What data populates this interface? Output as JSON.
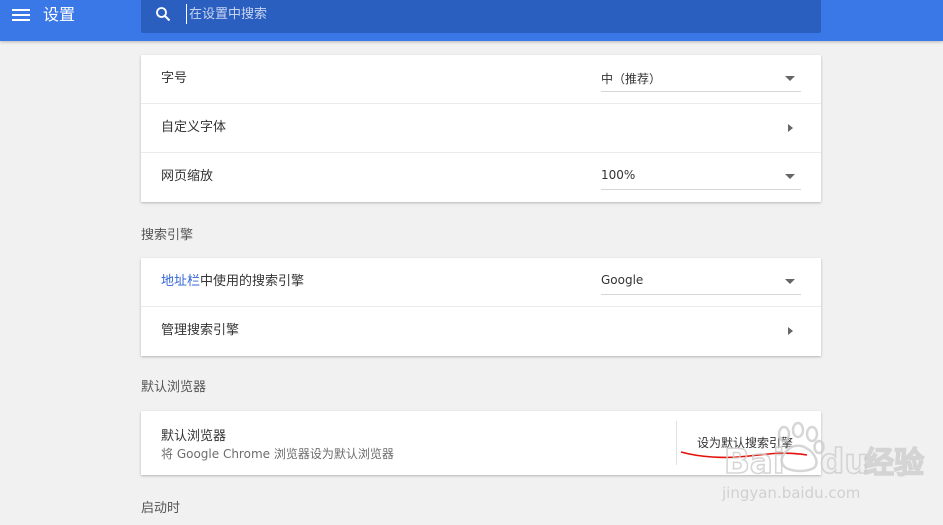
{
  "header": {
    "title": "设置",
    "search_placeholder": "在设置中搜索"
  },
  "appearance": {
    "font_size_label": "字号",
    "font_size_value": "中（推荐）",
    "custom_fonts_label": "自定义字体",
    "page_zoom_label": "网页缩放",
    "page_zoom_value": "100%"
  },
  "search_engine": {
    "section_title": "搜索引擎",
    "address_bar_link": "地址栏",
    "address_bar_rest": "中使用的搜索引擎",
    "engine_value": "Google",
    "manage_label": "管理搜索引擎"
  },
  "default_browser": {
    "section_title": "默认浏览器",
    "title": "默认浏览器",
    "subtitle": "将 Google Chrome 浏览器设为默认浏览器",
    "button_label": "设为默认搜索引擎"
  },
  "on_startup": {
    "section_title": "启动时"
  },
  "watermark": {
    "brand_text": "经验",
    "url_text": "jingyan.baidu.com"
  },
  "colors": {
    "header": "#3b78e7",
    "search_bg": "#2b5fbf",
    "link": "#3367d6",
    "annotation": "#e3120b"
  }
}
